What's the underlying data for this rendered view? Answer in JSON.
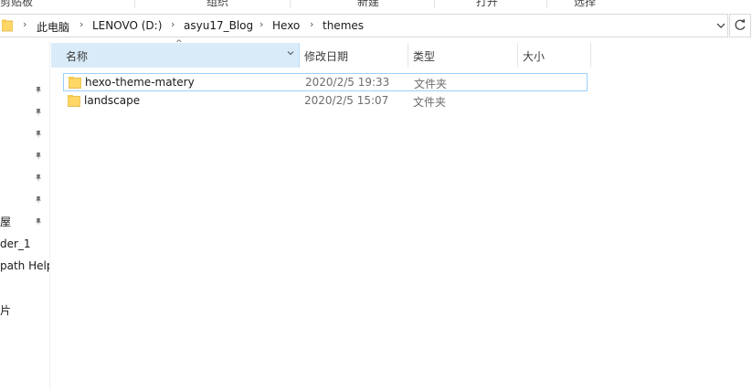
{
  "ribbon": {
    "groups": [
      "剪贴板",
      "组织",
      "新建",
      "打开",
      "选择"
    ]
  },
  "address_bar": {
    "breadcrumbs": [
      "此电脑",
      "LENOVO (D:)",
      "asyu17_Blog",
      "Hexo",
      "themes"
    ]
  },
  "nav_pane": {
    "items": [
      {
        "label": ""
      },
      {
        "label": ""
      },
      {
        "label": ""
      },
      {
        "label": ""
      },
      {
        "label": ""
      },
      {
        "label": ""
      },
      {
        "label": "屋"
      },
      {
        "label": "der_1"
      },
      {
        "label": "path Help"
      },
      {
        "label": "片"
      }
    ]
  },
  "columns": {
    "name": "名称",
    "date_modified": "修改日期",
    "type": "类型",
    "size": "大小"
  },
  "files": [
    {
      "name": "hexo-theme-matery",
      "date": "2020/2/5 19:33",
      "type": "文件夹",
      "size": ""
    },
    {
      "name": "landscape",
      "date": "2020/2/5 15:07",
      "type": "文件夹",
      "size": ""
    }
  ],
  "colors": {
    "header_selected": "#d9ebf9",
    "focus_border": "#99d1ff",
    "folder_yellow": "#ffd767"
  }
}
